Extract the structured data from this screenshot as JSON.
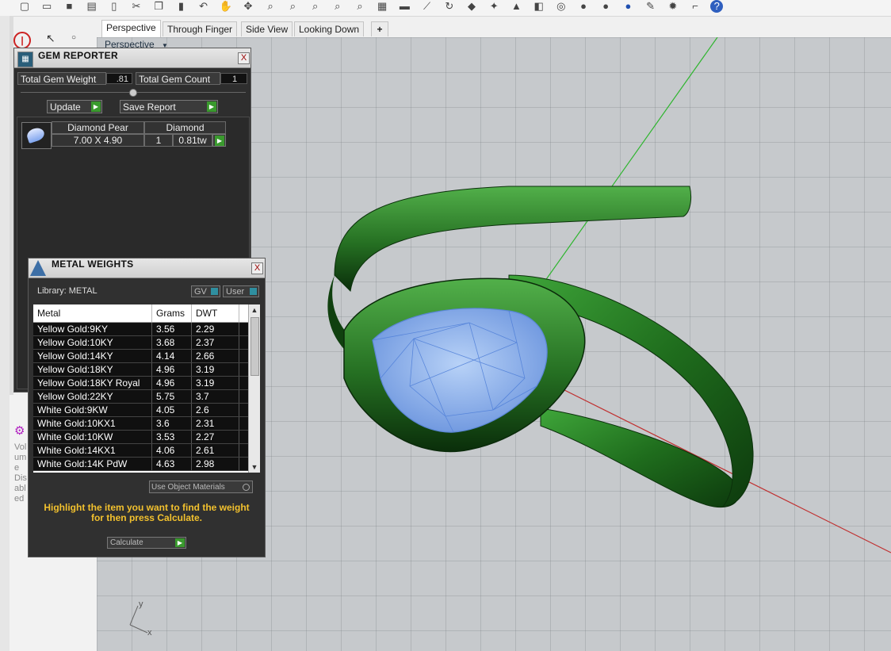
{
  "toolbar": {
    "icons": [
      "new-file-icon",
      "open-folder-icon",
      "save-icon",
      "print-icon",
      "page-icon",
      "cut-icon",
      "copy-icon",
      "paste-icon",
      "undo-icon",
      "pan-hand-icon",
      "rotate-icon",
      "zoom-icon",
      "zoom-window-icon",
      "zoom-extents-icon",
      "zoom-selected-icon",
      "zoom-target-icon",
      "grid-icon",
      "car-icon",
      "measure-icon",
      "cycle-icon",
      "snap-icon",
      "bulb-icon",
      "lock-icon",
      "layer-icon",
      "color-wheel-icon",
      "sphere-shaded-icon",
      "sphere-render-icon",
      "sphere-blue-icon",
      "brush-icon",
      "gear-icon",
      "dimension-icon",
      "help-icon"
    ]
  },
  "viewport_tabs": {
    "tabs": [
      "Perspective",
      "Through Finger",
      "Side View",
      "Looking Down"
    ],
    "add_symbol": "+",
    "viewport_label": "Perspective",
    "dropdown_symbol": "▼"
  },
  "axes": {
    "y": "y",
    "x": "x"
  },
  "gem_reporter": {
    "title": "GEM REPORTER",
    "close": "X",
    "total_weight_label": "Total Gem Weight",
    "total_weight_value": ".81",
    "total_count_label": "Total Gem Count",
    "total_count_value": "1",
    "update_button": "Update",
    "save_report_button": "Save Report",
    "gem": {
      "name": "Diamond Pear",
      "type": "Diamond",
      "size": "7.00 X 4.90",
      "count": "1",
      "weight": "0.81tw"
    }
  },
  "metal_weights": {
    "title": "METAL WEIGHTS",
    "close": "X",
    "library_label": "Library: METAL",
    "gv_label": "GV",
    "user_label": "User",
    "columns": [
      "Metal",
      "Grams",
      "DWT"
    ],
    "rows": [
      [
        "Yellow Gold:9KY",
        "3.56",
        "2.29"
      ],
      [
        "Yellow Gold:10KY",
        "3.68",
        "2.37"
      ],
      [
        "Yellow Gold:14KY",
        "4.14",
        "2.66"
      ],
      [
        "Yellow Gold:18KY",
        "4.96",
        "3.19"
      ],
      [
        "Yellow Gold:18KY Royal",
        "4.96",
        "3.19"
      ],
      [
        "Yellow Gold:22KY",
        "5.75",
        "3.7"
      ],
      [
        "White Gold:9KW",
        "4.05",
        "2.6"
      ],
      [
        "White Gold:10KX1",
        "3.6",
        "2.31"
      ],
      [
        "White Gold:10KW",
        "3.53",
        "2.27"
      ],
      [
        "White Gold:14KX1",
        "4.06",
        "2.61"
      ],
      [
        "White Gold:14K PdW",
        "4.63",
        "2.98"
      ]
    ],
    "use_object_materials": "Use Object Materials",
    "instruction": "Highlight the item you want to find the weight for then press Calculate.",
    "calculate_button": "Calculate"
  },
  "side_panel_text": [
    "Vol",
    "um",
    "e",
    "Dis",
    "abl",
    "ed"
  ],
  "colors": {
    "ring_green": "#2e8a2a",
    "gem_blue": "#8ab4f0",
    "instruction_yellow": "#f2c12e",
    "button_green": "#3a9a2e"
  }
}
